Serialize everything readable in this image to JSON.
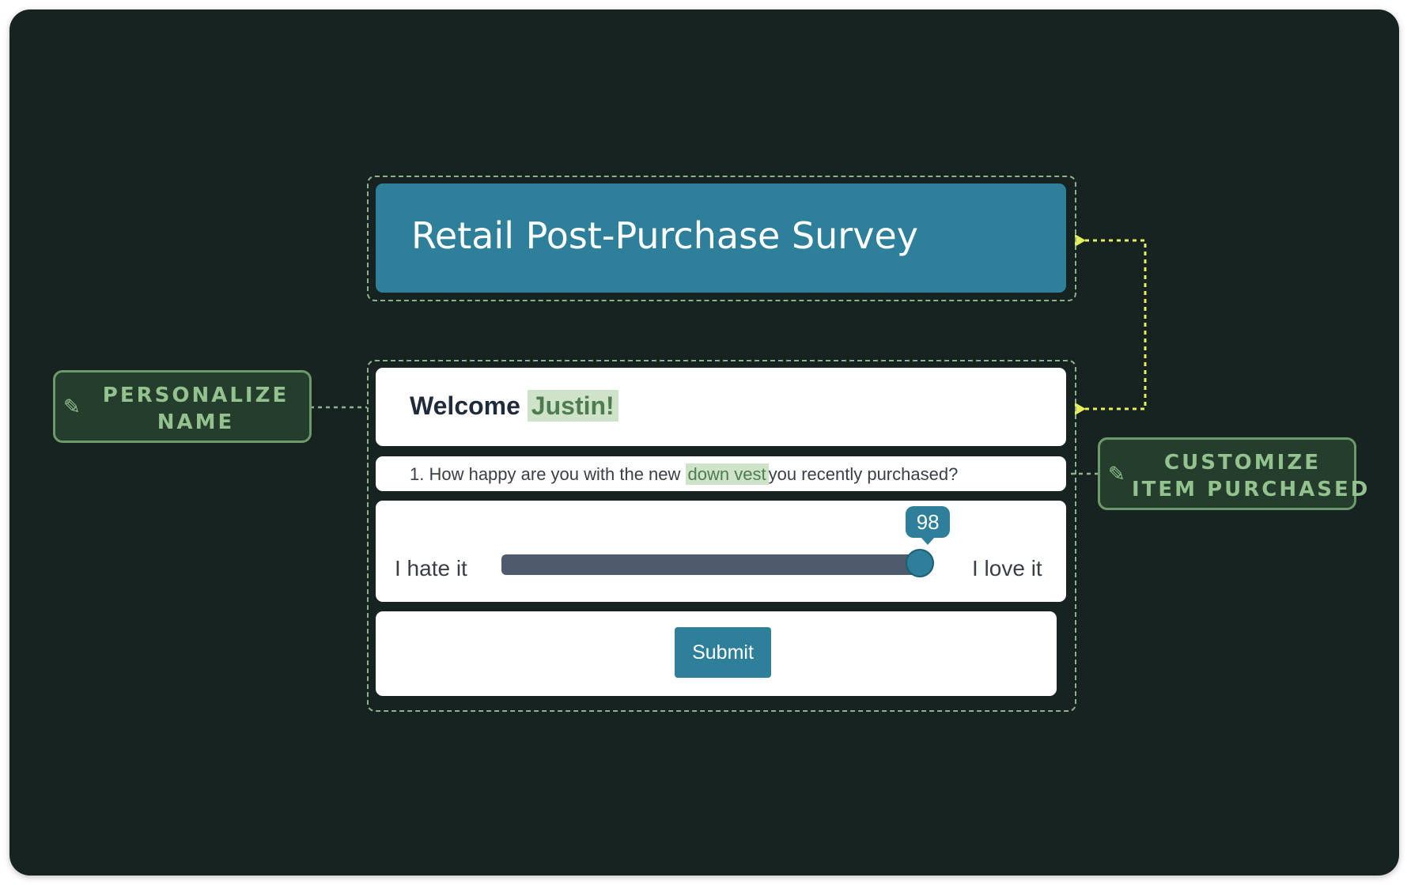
{
  "header": {
    "title": "Retail Post-Purchase Survey"
  },
  "welcome": {
    "prefix": "Welcome",
    "name": "Justin!"
  },
  "question": {
    "text_before": "1. How happy are you with the new",
    "item": "down vest",
    "text_after": "you recently purchased?"
  },
  "slider": {
    "min_label": "I hate it",
    "max_label": "I love it",
    "value": "98",
    "fraction": 0.98
  },
  "submit": {
    "label": "Submit"
  },
  "callouts": {
    "personalize": {
      "line1": "PERSONALIZE",
      "line2": "NAME",
      "icon": "pencil-icon"
    },
    "customize": {
      "line1": "CUSTOMIZE",
      "line2": "ITEM PURCHASED",
      "icon": "pencil-icon"
    }
  },
  "colors": {
    "background": "#172320",
    "accent": "#2d7f9a",
    "highlight": "#cfe3c9",
    "callout_text": "#93c28e",
    "connector_yellow": "#e6ee5c",
    "slider_track": "#4d5b6d"
  }
}
